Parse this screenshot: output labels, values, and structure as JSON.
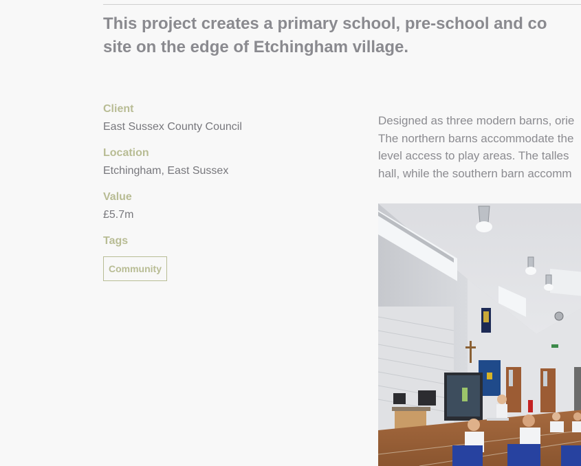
{
  "intro": {
    "line1": "This project creates a primary school, pre-school and co",
    "line2": "site on the edge of Etchingham village."
  },
  "details": {
    "client_label": "Client",
    "client_value": "East Sussex County Council",
    "location_label": "Location",
    "location_value": "Etchingham, East Sussex",
    "value_label": "Value",
    "value_value": "£5.7m",
    "tags_label": "Tags",
    "tags": [
      "Community"
    ]
  },
  "description": {
    "lines": [
      "Designed as three modern barns, orie",
      "The northern barns accommodate the",
      "level access to play areas. The talles",
      "hall, while the southern barn accomm"
    ]
  },
  "image": {
    "subject": "school-hall-interior-photo"
  },
  "colors": {
    "background": "#f8f8f8",
    "heading_text": "#8a8a8f",
    "label_accent": "#b8bc94",
    "value_text": "#77777c"
  }
}
